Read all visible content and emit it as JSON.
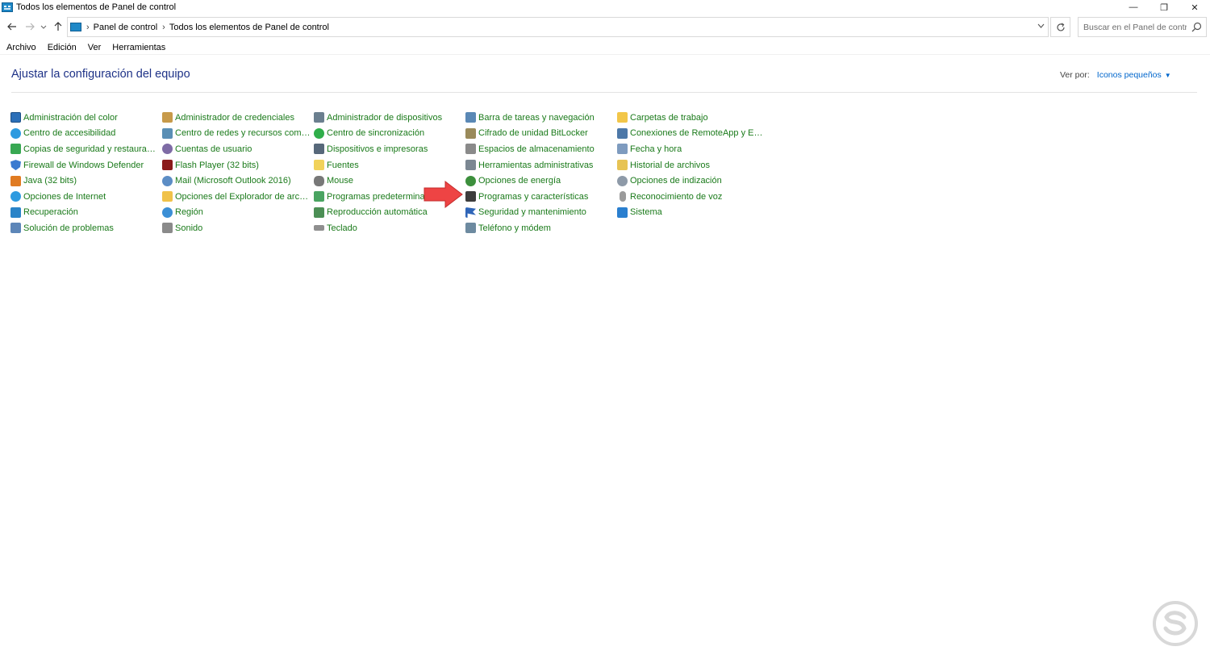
{
  "window": {
    "title": "Todos los elementos de Panel de control",
    "controls": [
      "—",
      "❐",
      "✕"
    ]
  },
  "address": {
    "crumbs": [
      "Panel de control",
      "Todos los elementos de Panel de control"
    ],
    "search_placeholder": "Buscar en el Panel de control"
  },
  "menu": {
    "items": [
      "Archivo",
      "Edición",
      "Ver",
      "Herramientas"
    ]
  },
  "header": {
    "title": "Ajustar la configuración del equipo",
    "viewby_label": "Ver por:",
    "viewby_value": "Iconos pequeños"
  },
  "items": [
    [
      {
        "label": "Administración del color",
        "icon": "monitor"
      },
      {
        "label": "Centro de accesibilidad",
        "icon": "globe"
      },
      {
        "label": "Copias de seguridad y restauración (...",
        "icon": "green"
      },
      {
        "label": "Firewall de Windows Defender",
        "icon": "shield"
      },
      {
        "label": "Java (32 bits)",
        "icon": "java"
      },
      {
        "label": "Opciones de Internet",
        "icon": "globe"
      },
      {
        "label": "Recuperación",
        "icon": "recover"
      },
      {
        "label": "Solución de problemas",
        "icon": "trouble"
      }
    ],
    [
      {
        "label": "Administrador de credenciales",
        "icon": "cred"
      },
      {
        "label": "Centro de redes y recursos comparti...",
        "icon": "network"
      },
      {
        "label": "Cuentas de usuario",
        "icon": "users"
      },
      {
        "label": "Flash Player (32 bits)",
        "icon": "flash"
      },
      {
        "label": "Mail (Microsoft Outlook 2016)",
        "icon": "mail"
      },
      {
        "label": "Opciones del Explorador de archivos",
        "icon": "folder"
      },
      {
        "label": "Región",
        "icon": "region"
      },
      {
        "label": "Sonido",
        "icon": "sound"
      }
    ],
    [
      {
        "label": "Administrador de dispositivos",
        "icon": "device"
      },
      {
        "label": "Centro de sincronización",
        "icon": "sync"
      },
      {
        "label": "Dispositivos e impresoras",
        "icon": "printer"
      },
      {
        "label": "Fuentes",
        "icon": "fonts"
      },
      {
        "label": "Mouse",
        "icon": "mouse"
      },
      {
        "label": "Programas predeterminados",
        "icon": "defaults"
      },
      {
        "label": "Reproducción automática",
        "icon": "autoplay"
      },
      {
        "label": "Teclado",
        "icon": "keyboard"
      }
    ],
    [
      {
        "label": "Barra de tareas y navegación",
        "icon": "taskbar"
      },
      {
        "label": "Cifrado de unidad BitLocker",
        "icon": "bitlocker"
      },
      {
        "label": "Espacios de almacenamiento",
        "icon": "storage"
      },
      {
        "label": "Herramientas administrativas",
        "icon": "admin"
      },
      {
        "label": "Opciones de energía",
        "icon": "power"
      },
      {
        "label": "Programas y características",
        "icon": "programs"
      },
      {
        "label": "Seguridad y mantenimiento",
        "icon": "flag"
      },
      {
        "label": "Teléfono y módem",
        "icon": "phone"
      }
    ],
    [
      {
        "label": "Carpetas de trabajo",
        "icon": "work"
      },
      {
        "label": "Conexiones de RemoteApp y Escrito...",
        "icon": "remote"
      },
      {
        "label": "Fecha y hora",
        "icon": "datetime"
      },
      {
        "label": "Historial de archivos",
        "icon": "history"
      },
      {
        "label": "Opciones de indización",
        "icon": "index"
      },
      {
        "label": "Reconocimiento de voz",
        "icon": "mic"
      },
      {
        "label": "Sistema",
        "icon": "system"
      }
    ]
  ],
  "colors": {
    "link_green": "#1a7a1a",
    "title_blue": "#1e3287",
    "accent_blue": "#0066cc",
    "annotation_red": "#ee4444"
  }
}
